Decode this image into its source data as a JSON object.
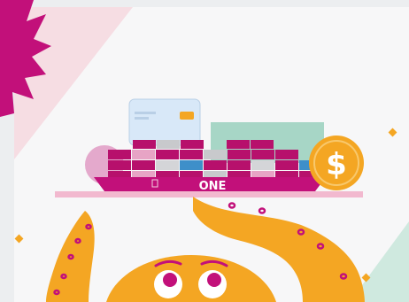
{
  "illustration": {
    "ship_hull_text": "ONE",
    "coin_symbol": "$",
    "colors": {
      "magenta": "#c2107a",
      "pink_light": "#f2b9cf",
      "orange": "#f4a623",
      "teal_light": "#a7d6c6",
      "blue_light": "#d8e8f8",
      "background": "#eceef0",
      "panel": "#f7f7f8"
    },
    "icons": [
      "burst-icon",
      "credit-card-icon",
      "container-ship-icon",
      "dollar-coin-icon",
      "octopus-icon"
    ]
  }
}
